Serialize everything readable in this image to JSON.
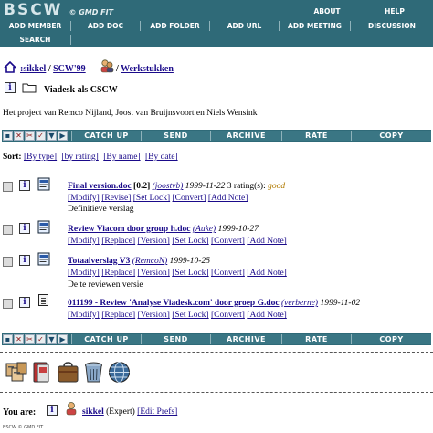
{
  "header": {
    "logo": "BSCW",
    "logo_sub": "© GMD FIT",
    "about": "ABOUT",
    "help": "HELP",
    "buttons": [
      "ADD MEMBER",
      "ADD DOC",
      "ADD FOLDER",
      "ADD URL",
      "ADD MEETING",
      "DISCUSSION",
      "SEARCH"
    ]
  },
  "breadcrumb": {
    "home": ":sikkel",
    "sep1": "/",
    "scw": "SCW'99",
    "sep2": "/",
    "current": "Werkstukken"
  },
  "folder": {
    "name": "Viadesk als CSCW",
    "description": "Het project van Remco Nijland, Joost van Bruijnsvoort en Niels Wensink"
  },
  "actions": [
    "CATCH UP",
    "SEND",
    "ARCHIVE",
    "RATE",
    "COPY"
  ],
  "sort": {
    "label": "Sort:",
    "options": [
      "[By type]",
      "[by rating]",
      "[By name]",
      "[By date]"
    ]
  },
  "items": [
    {
      "title": "Final version.doc",
      "version": "[0.2]",
      "owner": "(joostvb)",
      "date": "1999-11-22",
      "rating_count": "3 rating(s):",
      "rating": "good",
      "actions": [
        "[Modify]",
        "[Revise]",
        "[Set Lock]",
        "[Convert]",
        "[Add Note]"
      ],
      "note": "Definitieve verslag"
    },
    {
      "title": "Review Viacom door group h.doc",
      "owner": "(Auke)",
      "date": "1999-10-27",
      "actions": [
        "[Modify]",
        "[Replace]",
        "[Version]",
        "[Set Lock]",
        "[Convert]",
        "[Add Note]"
      ]
    },
    {
      "title": "Totaalverslag V3",
      "owner": "(RemcoN)",
      "date": "1999-10-25",
      "actions": [
        "[Modify]",
        "[Replace]",
        "[Version]",
        "[Set Lock]",
        "[Convert]",
        "[Add Note]"
      ],
      "note": "De te reviewen versie"
    },
    {
      "title": "011199 - Review 'Analyse Viadesk.com' door groep G.doc",
      "owner": "(verberne)",
      "date": "1999-11-02",
      "actions": [
        "[Modify]",
        "[Replace]",
        "[Version]",
        "[Set Lock]",
        "[Convert]",
        "[Add Note]"
      ]
    }
  ],
  "bottom_icons": [
    "clipboard-icon",
    "bookmarks-icon",
    "bag-icon",
    "trash-icon",
    "globe-icon"
  ],
  "footer": {
    "you_are": "You are:",
    "user": "sikkel",
    "role": "(Expert)",
    "edit_prefs": "[Edit Prefs]",
    "copyright": "BSCW © GMD FIT"
  },
  "colors": {
    "header_bg": "#2f6a78",
    "link": "#1a0a8a",
    "rating": "#b07a00"
  }
}
